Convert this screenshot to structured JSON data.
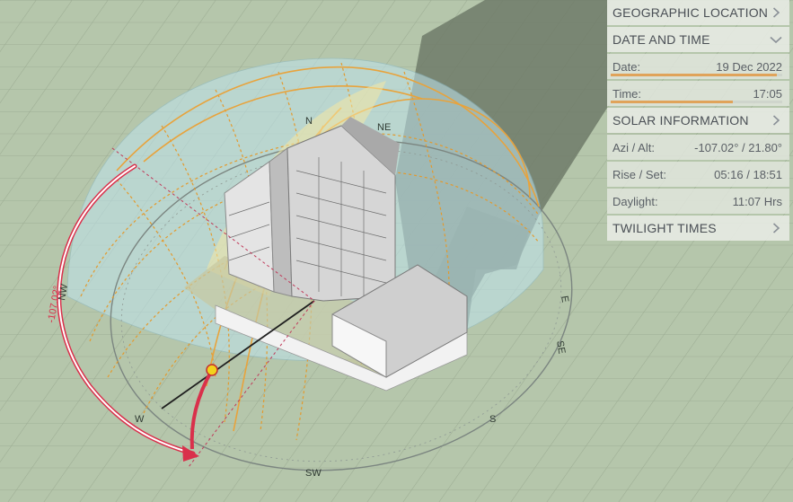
{
  "panel": {
    "geographic_location": {
      "title": "GEOGRAPHIC LOCATION"
    },
    "date_and_time": {
      "title": "DATE AND TIME",
      "date_label": "Date:",
      "date_value": "19 Dec 2022",
      "date_fraction": 0.97,
      "time_label": "Time:",
      "time_value": "17:05",
      "time_fraction": 0.71
    },
    "solar_information": {
      "title": "SOLAR INFORMATION",
      "azi_alt_label": "Azi / Alt:",
      "azi_alt_value": "-107.02° / 21.80°",
      "rise_set_label": "Rise / Set:",
      "rise_set_value": "05:16 / 18:51",
      "daylight_label": "Daylight:",
      "daylight_value": "11:07 Hrs"
    },
    "twilight_times": {
      "title": "TWILIGHT TIMES"
    }
  },
  "viewport": {
    "azimuth_label": "-107.02°",
    "direction_labels": [
      "N",
      "NW",
      "W",
      "SW",
      "S",
      "SE",
      "E",
      "NE"
    ],
    "colors": {
      "ground": "#b5c6ab",
      "grid_line": "#98a88f",
      "sky_dome": "#bfe4ee",
      "sun_path": "#e8a33c",
      "hour_lines": "#e39a2e",
      "azimuth_arc": "#d9304b",
      "sun_marker": "#f2d21c",
      "building": "#d8d8d8",
      "shadow": "#6e7a68",
      "panel_slider": "#e0a35a"
    }
  }
}
